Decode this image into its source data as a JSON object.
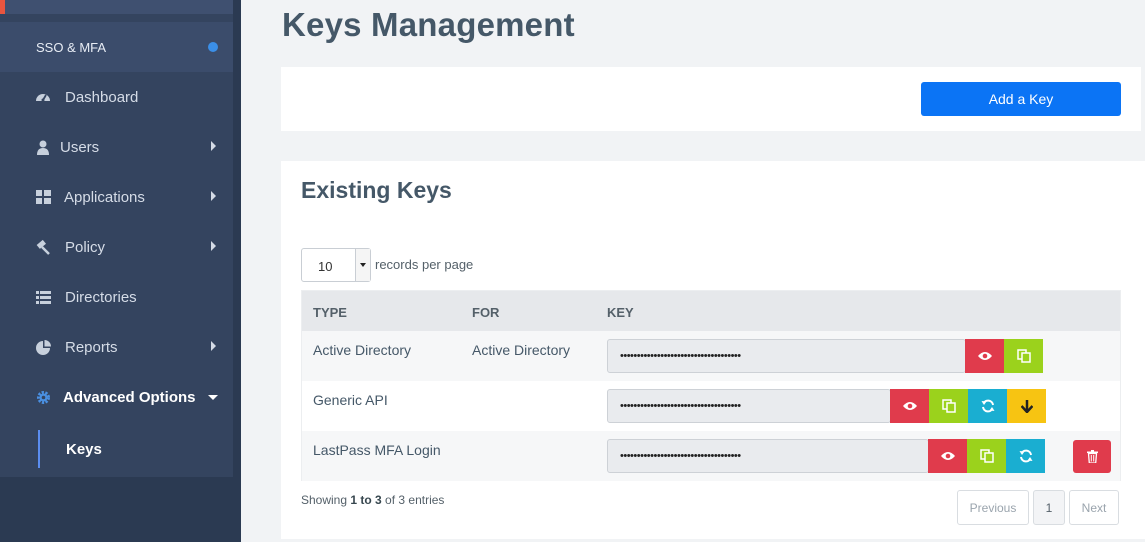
{
  "sidebar": {
    "sso_label": "SSO & MFA",
    "items": [
      {
        "label": "Dashboard",
        "icon": "dashboard-icon"
      },
      {
        "label": "Users",
        "icon": "user-icon"
      },
      {
        "label": "Applications",
        "icon": "grid-icon"
      },
      {
        "label": "Policy",
        "icon": "gavel-icon"
      },
      {
        "label": "Directories",
        "icon": "list-icon"
      },
      {
        "label": "Reports",
        "icon": "pie-chart-icon"
      },
      {
        "label": "Advanced Options",
        "icon": "gear-icon"
      }
    ],
    "sub_item": "Keys"
  },
  "page": {
    "title": "Keys Management",
    "add_button": "Add a Key",
    "section_title": "Existing Keys"
  },
  "table_controls": {
    "page_size": "10",
    "page_size_label": "records per page"
  },
  "table": {
    "headers": [
      "TYPE",
      "FOR",
      "KEY"
    ],
    "rows": [
      {
        "type": "Active Directory",
        "for": "Active Directory",
        "key": "••••••••••••••••••••••••••••••••••••"
      },
      {
        "type": "Generic API",
        "for": "",
        "key": "••••••••••••••••••••••••••••••••••••"
      },
      {
        "type": "LastPass MFA Login",
        "for": "",
        "key": "••••••••••••••••••••••••••••••••••••"
      }
    ]
  },
  "footer": {
    "showing_prefix": "Showing ",
    "showing_range": "1 to 3",
    "showing_suffix": " of 3 entries",
    "prev": "Previous",
    "page": "1",
    "next": "Next"
  },
  "colors": {
    "sidebar": "#2b3a52",
    "primary": "#0b74f5",
    "danger": "#e03b4c",
    "success": "#9bd21c",
    "info": "#1aaed1",
    "warning": "#f7c412"
  }
}
